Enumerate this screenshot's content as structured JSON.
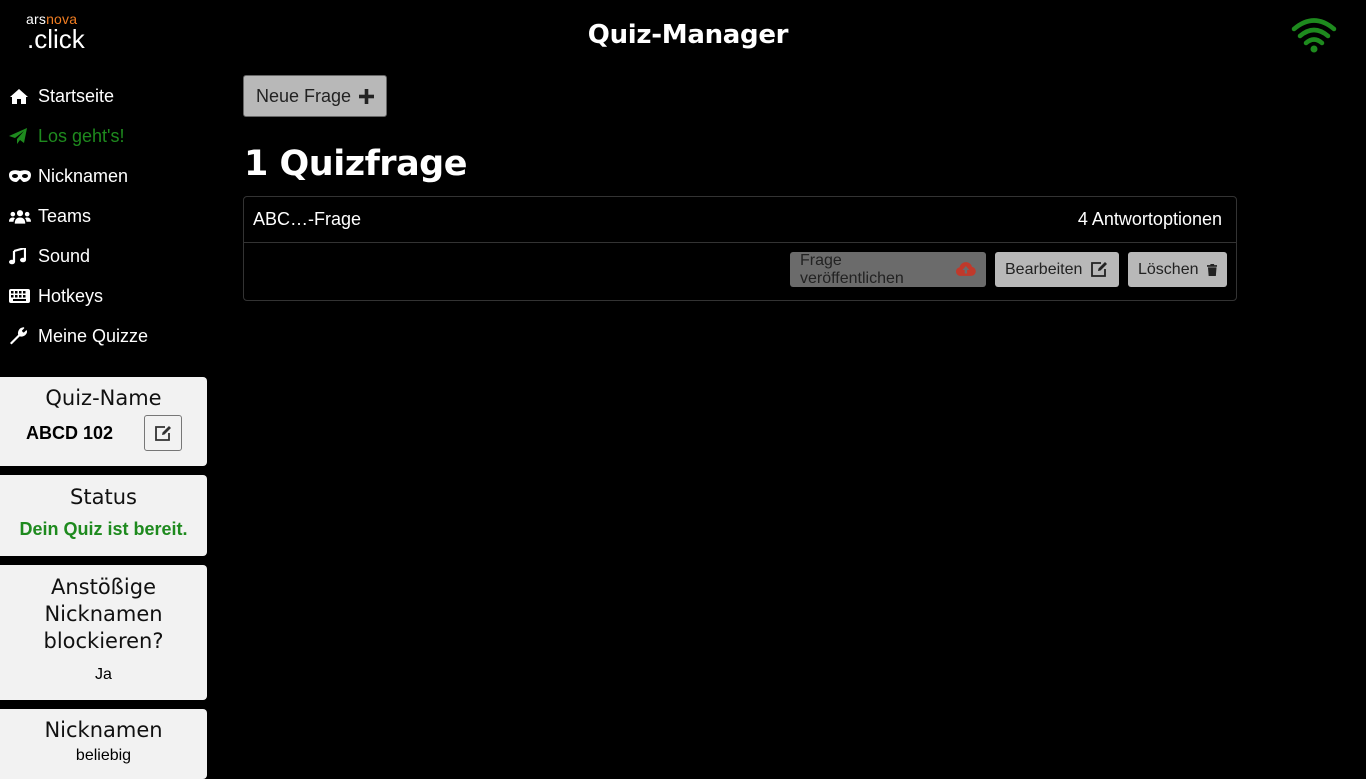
{
  "brand": {
    "top_a": "ars",
    "top_b": "nova",
    "bottom": ".click",
    "accent": "#f07d22"
  },
  "header": {
    "title": "Quiz-Manager",
    "wifi_icon": "wifi-icon",
    "wifi_color": "#1e8a1e"
  },
  "nav": [
    {
      "label": "Startseite",
      "icon": "home-icon"
    },
    {
      "label": "Los geht's!",
      "icon": "paper-plane-icon",
      "active": true
    },
    {
      "label": "Nicknamen",
      "icon": "mask-icon"
    },
    {
      "label": "Teams",
      "icon": "users-icon"
    },
    {
      "label": "Sound",
      "icon": "music-icon"
    },
    {
      "label": "Hotkeys",
      "icon": "keyboard-icon"
    },
    {
      "label": "Meine Quizze",
      "icon": "wrench-icon"
    }
  ],
  "cards": {
    "quiz_name": {
      "title": "Quiz-Name",
      "value": "ABCD 102"
    },
    "status": {
      "title": "Status",
      "value": "Dein Quiz ist bereit.",
      "color": "#1e8a1e"
    },
    "block": {
      "title_1": "Anstößige",
      "title_2": "Nicknamen",
      "title_3": "blockieren?",
      "value": "Ja"
    },
    "nicknames": {
      "title": "Nicknamen",
      "value": "beliebig"
    }
  },
  "main": {
    "new_question": "Neue Frage",
    "count_title": "1 Quizfrage",
    "question": {
      "type": "ABC…-Frage",
      "options": "4 Antwortoptionen",
      "publish": "Frage veröffentlichen",
      "edit": "Bearbeiten",
      "delete": "Löschen"
    }
  }
}
